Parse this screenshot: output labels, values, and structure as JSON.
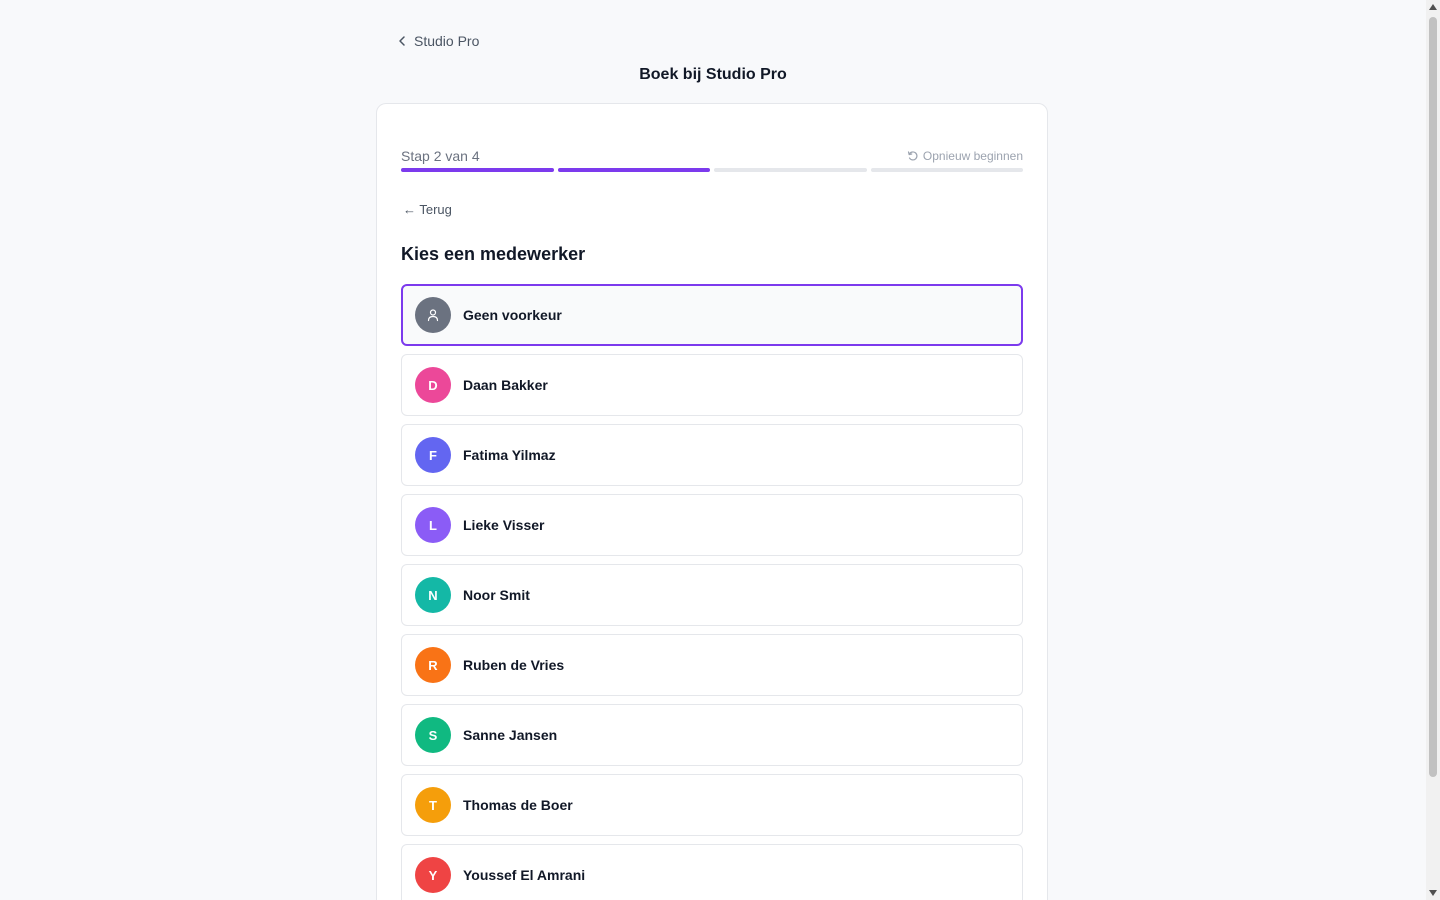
{
  "header": {
    "back_link": "Studio Pro",
    "title": "Boek bij Studio Pro"
  },
  "wizard": {
    "step_label": "Stap 2 van 4",
    "current_step": 2,
    "total_steps": 4,
    "restart_label": "Opnieuw beginnen",
    "back_label": "← Terug",
    "section_title": "Kies een medewerker",
    "accent_color": "#7c3aed"
  },
  "staff": [
    {
      "name": "Geen voorkeur",
      "initial": "",
      "icon": "user-icon",
      "color": "#6b7280",
      "selected": true
    },
    {
      "name": "Daan Bakker",
      "initial": "D",
      "color": "#ec4899"
    },
    {
      "name": "Fatima Yilmaz",
      "initial": "F",
      "color": "#6366f1"
    },
    {
      "name": "Lieke Visser",
      "initial": "L",
      "color": "#8b5cf6"
    },
    {
      "name": "Noor Smit",
      "initial": "N",
      "color": "#14b8a6"
    },
    {
      "name": "Ruben de Vries",
      "initial": "R",
      "color": "#f97316"
    },
    {
      "name": "Sanne Jansen",
      "initial": "S",
      "color": "#10b981"
    },
    {
      "name": "Thomas de Boer",
      "initial": "T",
      "color": "#f59e0b"
    },
    {
      "name": "Youssef El Amrani",
      "initial": "Y",
      "color": "#ef4444"
    }
  ]
}
